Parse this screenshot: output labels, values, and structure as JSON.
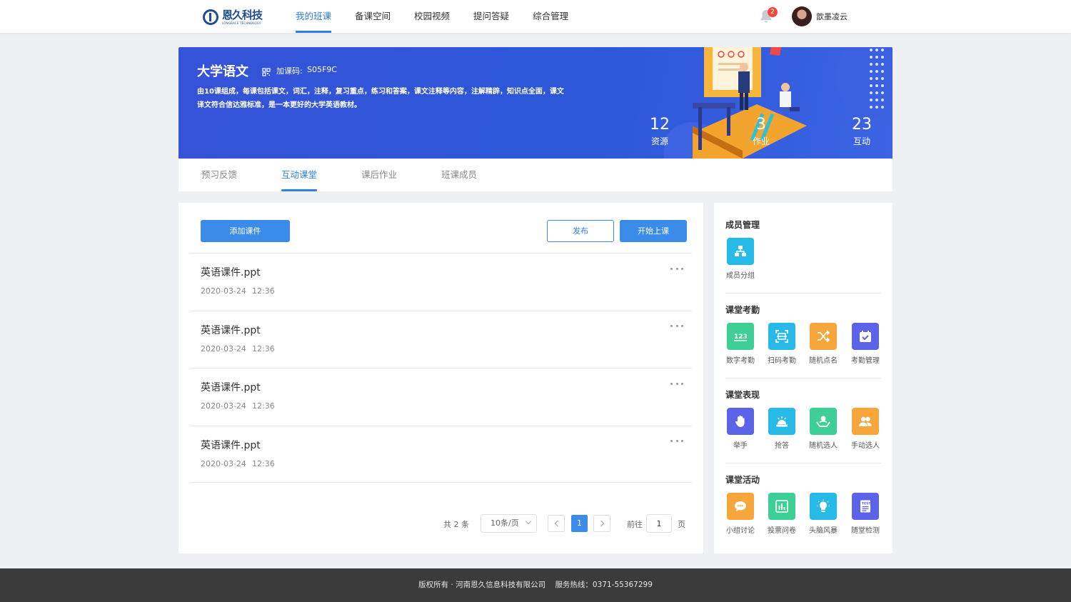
{
  "header": {
    "logo_cn": "恩久科技",
    "logo_en": "LONGRACE TECHNOLOGY",
    "nav": [
      {
        "label": "我的班课",
        "active": true
      },
      {
        "label": "备课空间"
      },
      {
        "label": "校园视频"
      },
      {
        "label": "提问答疑"
      },
      {
        "label": "综合管理"
      }
    ],
    "notification_count": "2",
    "username": "歆墨凌云"
  },
  "course": {
    "title": "大学语文",
    "join_label": "加课码:",
    "join_code": "S05F9C",
    "description": "由10课组成，每课包括课文，词汇，注释，复习重点，练习和答案，课文注释等内容，注解精辟，知识点全面，课文译文符合信达雅标准，是一本更好的大学英语教材。",
    "stats": [
      {
        "num": "12",
        "label": "资源"
      },
      {
        "num": "3",
        "label": "作业"
      },
      {
        "num": "23",
        "label": "互动"
      }
    ],
    "tabs": [
      {
        "label": "预习反馈"
      },
      {
        "label": "互动课堂",
        "active": true
      },
      {
        "label": "课后作业"
      },
      {
        "label": "班课成员"
      }
    ]
  },
  "main": {
    "add_button": "添加课件",
    "publish_button": "发布",
    "start_button": "开始上课",
    "files": [
      {
        "name": "英语课件.ppt",
        "date": "2020-03-24",
        "time": "12:36"
      },
      {
        "name": "英语课件.ppt",
        "date": "2020-03-24",
        "time": "12:36"
      },
      {
        "name": "英语课件.ppt",
        "date": "2020-03-24",
        "time": "12:36"
      },
      {
        "name": "英语课件.ppt",
        "date": "2020-03-24",
        "time": "12:36"
      }
    ],
    "pagination": {
      "total": "共 2 条",
      "page_size": "10条/页",
      "current": "1",
      "goto_label": "前往",
      "goto_value": "1",
      "page_suffix": "页"
    }
  },
  "side": {
    "sections": [
      {
        "title": "成员管理",
        "tools": [
          {
            "label": "成员分组",
            "icon": "group-tree-icon",
            "color": "#27b9e8"
          }
        ]
      },
      {
        "title": "课堂考勤",
        "tools": [
          {
            "label": "数字考勤",
            "icon": "number-123-icon",
            "color": "#3ecf96"
          },
          {
            "label": "扫码考勤",
            "icon": "scan-code-icon",
            "color": "#27b9e8"
          },
          {
            "label": "随机点名",
            "icon": "shuffle-icon",
            "color": "#f7a63b"
          },
          {
            "label": "考勤管理",
            "icon": "calendar-check-icon",
            "color": "#5b63e8"
          }
        ]
      },
      {
        "title": "课堂表现",
        "tools": [
          {
            "label": "举手",
            "icon": "raise-hand-icon",
            "color": "#5b63e8"
          },
          {
            "label": "抢答",
            "icon": "buzzer-icon",
            "color": "#27b9e8"
          },
          {
            "label": "随机选人",
            "icon": "hand-person-icon",
            "color": "#3ecf96"
          },
          {
            "label": "手动选人",
            "icon": "people-icon",
            "color": "#f7a63b"
          }
        ]
      },
      {
        "title": "课堂活动",
        "tools": [
          {
            "label": "小组讨论",
            "icon": "chat-bubble-icon",
            "color": "#f7a63b"
          },
          {
            "label": "投票问卷",
            "icon": "bar-chart-icon",
            "color": "#3ecf96"
          },
          {
            "label": "头脑风暴",
            "icon": "lightbulb-icon",
            "color": "#27b9e8"
          },
          {
            "label": "随堂检测",
            "icon": "test-paper-icon",
            "color": "#5b63e8"
          }
        ]
      }
    ]
  },
  "footer": {
    "copyright": "版权所有 · 河南恩久信息科技有限公司",
    "hotline": "服务热线：0371-55367299"
  }
}
